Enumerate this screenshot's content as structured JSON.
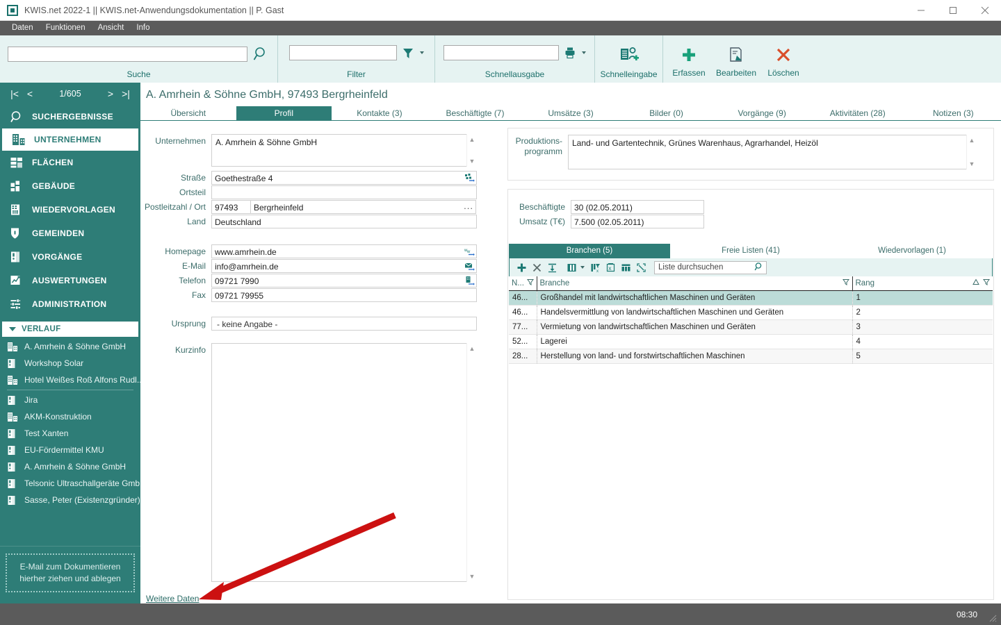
{
  "window": {
    "title": "KWIS.net 2022-1 || KWIS.net-Anwendungsdokumentation || P. Gast",
    "minimize": "minimize-icon",
    "maximize": "maximize-icon",
    "close": "close-icon"
  },
  "menubar": {
    "items": [
      "Daten",
      "Funktionen",
      "Ansicht",
      "Info"
    ]
  },
  "ribbon": {
    "groups": [
      {
        "label": "Suche",
        "value": "",
        "icon": "search-icon"
      },
      {
        "label": "Filter",
        "value": "",
        "icon": "filter-icon"
      },
      {
        "label": "Schnellausgabe",
        "value": "",
        "icon": "printer-icon"
      }
    ],
    "commands": [
      {
        "label": "Schnelleingabe",
        "icon": "quick-entry-icon"
      },
      {
        "label": "Erfassen",
        "icon": "plus-icon"
      },
      {
        "label": "Bearbeiten",
        "icon": "edit-icon"
      },
      {
        "label": "Löschen",
        "icon": "delete-x-icon"
      }
    ]
  },
  "sidebar": {
    "pager": {
      "first": "|<",
      "prev": "<",
      "count": "1/605",
      "next": ">",
      "last": ">|"
    },
    "nav": [
      {
        "label": "SUCHERGEBNISSE",
        "icon": "search-results-icon",
        "active": false
      },
      {
        "label": "UNTERNEHMEN",
        "icon": "company-icon",
        "active": true
      },
      {
        "label": "FLÄCHEN",
        "icon": "areas-icon",
        "active": false
      },
      {
        "label": "GEBÄUDE",
        "icon": "building-icon",
        "active": false
      },
      {
        "label": "WIEDERVORLAGEN",
        "icon": "resubmission-icon",
        "active": false
      },
      {
        "label": "GEMEINDEN",
        "icon": "shield-icon",
        "active": false
      },
      {
        "label": "VORGÄNGE",
        "icon": "folder-binder-icon",
        "active": false
      },
      {
        "label": "AUSWERTUNGEN",
        "icon": "chart-icon",
        "active": false
      },
      {
        "label": "ADMINISTRATION",
        "icon": "sliders-icon",
        "active": false
      }
    ],
    "history": {
      "title": "VERLAUF",
      "items": [
        {
          "label": "A. Amrhein & Söhne GmbH",
          "icon": "company-icon"
        },
        {
          "label": "Workshop Solar",
          "icon": "binder-icon"
        },
        {
          "label": "Hotel Weißes Roß Alfons Rudl...",
          "icon": "company-icon"
        },
        {
          "label": "Jira",
          "icon": "binder-icon"
        },
        {
          "label": "AKM-Konstruktion",
          "icon": "company-icon"
        },
        {
          "label": "Test Xanten",
          "icon": "binder-icon"
        },
        {
          "label": "EU-Fördermittel KMU",
          "icon": "binder-icon"
        },
        {
          "label": "A. Amrhein & Söhne GmbH",
          "icon": "binder-icon"
        },
        {
          "label": "Telsonic Ultraschallgeräte Gmb...",
          "icon": "binder-icon"
        },
        {
          "label": "Sasse, Peter (Existenzgründer)",
          "icon": "binder-icon"
        }
      ]
    },
    "dropzone": {
      "line1": "E-Mail  zum Dokumentieren",
      "line2": "hierher ziehen und ablegen"
    }
  },
  "main": {
    "page_title": "A. Amrhein & Söhne GmbH, 97493 Bergrheinfeld",
    "tabs": [
      {
        "label": "Übersicht",
        "active": false
      },
      {
        "label": "Profil",
        "active": true
      },
      {
        "label": "Kontakte (3)",
        "active": false
      },
      {
        "label": "Beschäftigte (7)",
        "active": false
      },
      {
        "label": "Umsätze (3)",
        "active": false
      },
      {
        "label": "Bilder (0)",
        "active": false
      },
      {
        "label": "Vorgänge (9)",
        "active": false
      },
      {
        "label": "Aktivitäten (28)",
        "active": false
      },
      {
        "label": "Notizen (3)",
        "active": false
      }
    ],
    "form": {
      "unternehmen": {
        "label": "Unternehmen",
        "value": "A. Amrhein & Söhne GmbH"
      },
      "strasse": {
        "label": "Straße",
        "value": "Goethestraße 4",
        "icon": "map-pin-icon"
      },
      "ortsteil": {
        "label": "Ortsteil",
        "value": ""
      },
      "plz_ort": {
        "label": "Postleitzahl / Ort",
        "plz": "97493",
        "ort": "Bergrheinfeld",
        "more": "..."
      },
      "land": {
        "label": "Land",
        "value": "Deutschland"
      },
      "homepage": {
        "label": "Homepage",
        "value": "www.amrhein.de",
        "icon": "web-link-icon"
      },
      "email": {
        "label": "E-Mail",
        "value": "info@amrhein.de",
        "icon": "mail-icon"
      },
      "telefon": {
        "label": "Telefon",
        "value": "09721 7990",
        "icon": "phone-icon"
      },
      "fax": {
        "label": "Fax",
        "value": "09721 79955"
      },
      "ursprung": {
        "label": "Ursprung",
        "value": "- keine Angabe -"
      },
      "kurzinfo": {
        "label": "Kurzinfo",
        "value": ""
      }
    },
    "weitere_daten": "Weitere Daten",
    "right": {
      "produktionsprogramm": {
        "label_line1": "Produktions-",
        "label_line2": "programm",
        "value": "Land- und Gartentechnik, Grünes Warenhaus, Agrarhandel, Heizöl"
      },
      "beschaeftigte": {
        "label": "Beschäftigte",
        "value": "30  (02.05.2011)"
      },
      "umsatz": {
        "label": "Umsatz (T€)",
        "value": "7.500 (02.05.2011)"
      },
      "subtabs": [
        {
          "label": "Branchen (5)",
          "active": true
        },
        {
          "label": "Freie Listen (41)",
          "active": false
        },
        {
          "label": "Wiedervorlagen (1)",
          "active": false
        }
      ],
      "grid_toolbar": {
        "buttons": [
          "add-icon",
          "remove-x-icon",
          "import-down-icon",
          "columns-icon",
          "columns-dropdown-caret",
          "clear-filter-icon",
          "excel-export-icon",
          "layout-icon",
          "expand-icon"
        ],
        "search_placeholder": "Liste durchsuchen",
        "search_icon": "search-icon"
      },
      "grid": {
        "columns": [
          {
            "label": "N...",
            "filter_icon": "filter-icon"
          },
          {
            "label": "Branche",
            "filter_icon": "filter-icon"
          },
          {
            "label": "Rang",
            "sort_icon": "sort-asc-icon",
            "filter_icon": "filter-icon"
          }
        ],
        "rows": [
          {
            "nr": "46...",
            "branche": "Großhandel mit landwirtschaftlichen Maschinen und Geräten",
            "rang": "1",
            "selected": true
          },
          {
            "nr": "46...",
            "branche": "Handelsvermittlung von landwirtschaftlichen Maschinen und Geräten",
            "rang": "2",
            "selected": false
          },
          {
            "nr": "77...",
            "branche": "Vermietung von landwirtschaftlichen Maschinen und Geräten",
            "rang": "3",
            "selected": false
          },
          {
            "nr": "52...",
            "branche": "Lagerei",
            "rang": "4",
            "selected": false
          },
          {
            "nr": "28...",
            "branche": "Herstellung von land- und forstwirtschaftlichen Maschinen",
            "rang": "5",
            "selected": false
          }
        ]
      }
    }
  },
  "statusbar": {
    "time": "08:30"
  },
  "colors": {
    "teal": "#2e7d77",
    "ribbon_bg": "#e6f3f2",
    "accent_blue": "#5a7fd6",
    "selection": "#bcdcd8",
    "annotation_red": "#cc1111"
  }
}
